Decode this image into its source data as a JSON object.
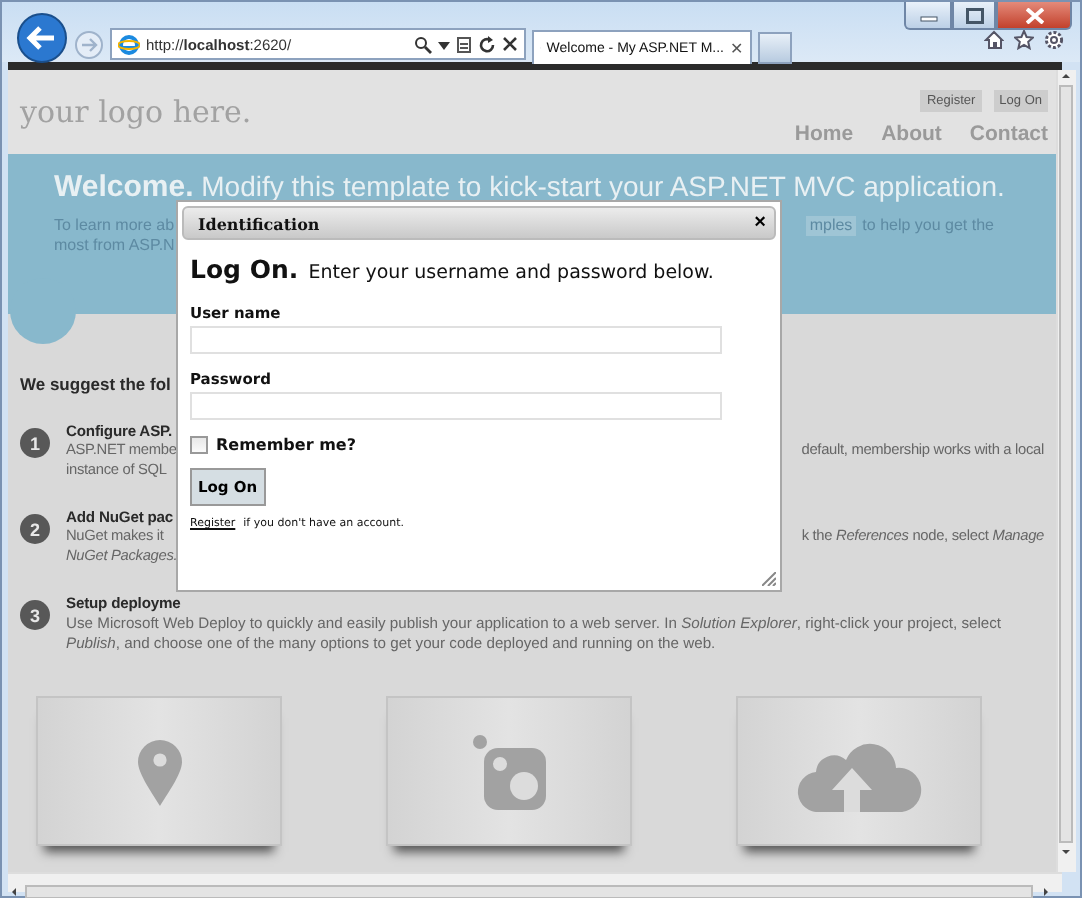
{
  "browser": {
    "address": "http://**localhost**:2620/",
    "tab_title": "Welcome - My ASP.NET M...",
    "tab_close": "✕"
  },
  "header": {
    "logo": "your logo here.",
    "account_links": [
      "Register",
      "Log On"
    ],
    "nav": [
      "Home",
      "About",
      "Contact"
    ]
  },
  "featured": {
    "heading_bold": "Welcome.",
    "heading": "Modify this template to kick-start your ASP.NET MVC application.",
    "line_1_left": "To learn more ab",
    "line_1_link": "mples",
    "line_1_right": "to help you get the",
    "line_2_left": "most from ASP.N"
  },
  "suggestions": {
    "heading": "We suggest the fol",
    "steps": [
      {
        "number": "1",
        "title": "Configure ASP.",
        "kind": "split",
        "lines": [
          {
            "left": "ASP.NET membe",
            "right": "default, membership works with a local"
          },
          {
            "left": "instance of SQL"
          }
        ]
      },
      {
        "number": "2",
        "title": "Add NuGet pac",
        "kind": "split",
        "lines": [
          {
            "left": "NuGet makes it",
            "right": "k the *References* node, select *Manage*"
          },
          {
            "left": "*NuGet Packages.*"
          }
        ]
      },
      {
        "number": "3",
        "title": "Setup deployme",
        "kind": "full",
        "text": "Use Microsoft Web Deploy to quickly and easily publish your application to a web server. In *Solution Explorer*, right-click your project, select *Publish*, and choose one of the many options to get your code deployed and running on the web."
      }
    ]
  },
  "dialog": {
    "title": "Identification",
    "close": "×",
    "heading": "Log On.",
    "intro": "Enter your username and password below.",
    "fields": [
      {
        "label": "User name"
      },
      {
        "label": "Password"
      }
    ],
    "remember": {
      "label": "Remember me?",
      "checked": false
    },
    "submit": "Log On",
    "register_link": "Register",
    "register_note": "if you don't have an account."
  }
}
